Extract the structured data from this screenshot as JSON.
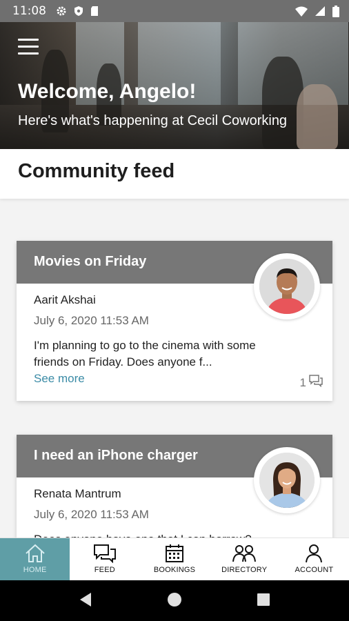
{
  "status_bar": {
    "time": "11:08"
  },
  "hero": {
    "title": "Welcome, Angelo!",
    "subtitle": "Here's what's happening at Cecil Coworking"
  },
  "feed": {
    "title": "Community feed"
  },
  "posts": [
    {
      "title": "Movies on Friday",
      "author": "Aarit Akshai",
      "date": "July 6, 2020 11:53 AM",
      "body": "I'm planning to go to the cinema with some friends on Friday. Does anyone f...",
      "see_more": "See more",
      "comments": "1"
    },
    {
      "title": "I need an iPhone charger",
      "author": "Renata Mantrum",
      "date": "July 6, 2020 11:53 AM",
      "body": "Does anyone have one that I can borrow?"
    }
  ],
  "bottom_nav": {
    "items": [
      {
        "label": "HOME",
        "icon": "home-icon",
        "active": true
      },
      {
        "label": "FEED",
        "icon": "feed-icon"
      },
      {
        "label": "BOOKINGS",
        "icon": "calendar-icon"
      },
      {
        "label": "DIRECTORY",
        "icon": "people-icon"
      },
      {
        "label": "ACCOUNT",
        "icon": "person-icon"
      }
    ]
  },
  "colors": {
    "accent": "#5f9ea6",
    "card_header": "#777777",
    "link": "#3b8ba6",
    "status_bar": "#6f6f6f"
  }
}
